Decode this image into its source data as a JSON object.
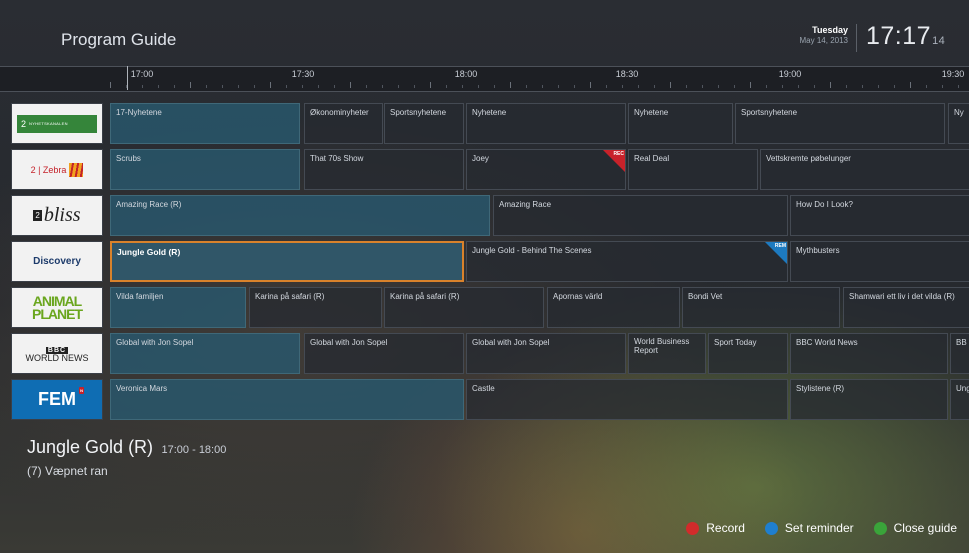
{
  "header": {
    "title": "Program Guide",
    "day": "Tuesday",
    "date": "May 14, 2013",
    "clock": "17:17",
    "seconds": "14"
  },
  "timeline": [
    "17:00",
    "17:30",
    "18:00",
    "18:30",
    "19:00",
    "19:30"
  ],
  "channels": [
    {
      "name": "NRK2 Nyhetskanalen",
      "logo": "2",
      "logo_sub": "NYHETSKANALEN"
    },
    {
      "name": "NRK2 Zebra",
      "logo": "2 | Zebra"
    },
    {
      "name": "Bliss",
      "logo": "bliss",
      "logo_prefix": "2"
    },
    {
      "name": "Discovery",
      "logo": "Discovery"
    },
    {
      "name": "Animal Planet",
      "logo": "ANIMAL PLANET"
    },
    {
      "name": "BBC World News",
      "logo_top": "BBC",
      "logo": "WORLD NEWS"
    },
    {
      "name": "FEM",
      "logo": "FEM",
      "logo_badge": "N"
    }
  ],
  "rows": [
    [
      "17-Nyhetene",
      "Økonominyheter",
      "Sportsnyhetene",
      "Nyhetene",
      "Nyhetene",
      "Sportsnyhetene",
      "Ny"
    ],
    [
      "Scrubs",
      "That 70s Show",
      "Joey",
      "Real Deal",
      "Vettskremte pøbelunger"
    ],
    [
      "Amazing Race (R)",
      "Amazing Race",
      "How Do I Look?"
    ],
    [
      "Jungle Gold (R)",
      "Jungle Gold - Behind The Scenes",
      "Mythbusters"
    ],
    [
      "Vilda familjen",
      "Karina på safari (R)",
      "Karina på safari (R)",
      "Apornas värld",
      "Bondi Vet",
      "Shamwari ett liv i det vilda (R)"
    ],
    [
      "Global with Jon Sopel",
      "Global with Jon Sopel",
      "Global with Jon Sopel",
      "World Business Report",
      "Sport Today",
      "BBC World News",
      "BB"
    ],
    [
      "Veronica Mars",
      "Castle",
      "Stylistene (R)",
      "Ung"
    ]
  ],
  "flags": {
    "rec": "REC",
    "rem": "REM"
  },
  "details": {
    "name": "Jungle Gold (R)",
    "time": "17:00 - 18:00",
    "episode": "(7) Væpnet ran"
  },
  "actions": [
    {
      "label": "Record",
      "color": "#d22b2b"
    },
    {
      "label": "Set reminder",
      "color": "#1f7fcf"
    },
    {
      "label": "Close guide",
      "color": "#3aa43a"
    }
  ]
}
